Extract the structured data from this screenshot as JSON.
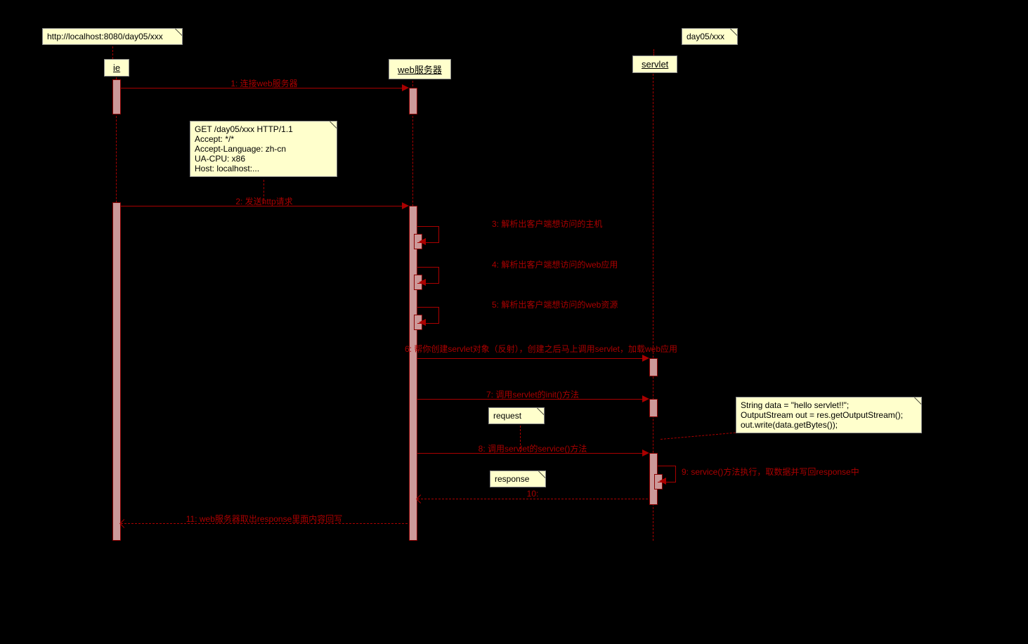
{
  "actors": {
    "ie": "ie",
    "web_server": "web服务器",
    "servlet": "servlet"
  },
  "notes": {
    "url": "http://localhost:8080/day05/xxx",
    "app": "day05/xxx",
    "http_request": "GET /day05/xxx HTTP/1.1\nAccept: */*\nAccept-Language: zh-cn\nUA-CPU: x86\nHost: localhost:...",
    "request_obj": "request",
    "response_obj": "response",
    "servlet_code": "String data = \"hello servlet!!\";\nOutputStream out = res.getOutputStream();\nout.write(data.getBytes());"
  },
  "messages": {
    "m1": "1: 连接web服务器",
    "m2": "2: 发送http请求",
    "m3": "3: 解析出客户端想访问的主机",
    "m4": "4: 解析出客户端想访问的web应用",
    "m5": "5: 解析出客户端想访问的web资源",
    "m6": "6: 帮你创建servlet对象（反射），创建之后马上调用servlet，加载web应用",
    "m7": "7: 调用servlet的init()方法",
    "m8": "8: 调用servlet的service()方法",
    "m9": "9: service()方法执行，取数据并写回response中",
    "m10": "10:",
    "m11": "11: web服务器取出response里面内容回写"
  },
  "chart_data": {
    "type": "sequence_diagram",
    "participants": [
      "ie",
      "web服务器",
      "servlet"
    ],
    "interactions": [
      {
        "from": "ie",
        "to": "web服务器",
        "label": "1: 连接web服务器",
        "type": "sync"
      },
      {
        "from": "ie",
        "to": "web服务器",
        "label": "2: 发送http请求",
        "type": "sync",
        "note": "GET /day05/xxx HTTP/1.1..."
      },
      {
        "from": "web服务器",
        "to": "web服务器",
        "label": "3: 解析出客户端想访问的主机",
        "type": "self"
      },
      {
        "from": "web服务器",
        "to": "web服务器",
        "label": "4: 解析出客户端想访问的web应用",
        "type": "self"
      },
      {
        "from": "web服务器",
        "to": "web服务器",
        "label": "5: 解析出客户端想访问的web资源",
        "type": "self"
      },
      {
        "from": "web服务器",
        "to": "servlet",
        "label": "6: 帮你创建servlet对象（反射），创建之后马上调用servlet，加载web应用",
        "type": "sync"
      },
      {
        "from": "web服务器",
        "to": "servlet",
        "label": "7: 调用servlet的init()方法",
        "type": "sync"
      },
      {
        "from": "web服务器",
        "to": "servlet",
        "label": "8: 调用servlet的service()方法",
        "type": "sync",
        "note_obj": "request"
      },
      {
        "from": "servlet",
        "to": "servlet",
        "label": "9: service()方法执行，取数据并写回response中",
        "type": "self"
      },
      {
        "from": "servlet",
        "to": "web服务器",
        "label": "10:",
        "type": "return",
        "note_obj": "response"
      },
      {
        "from": "web服务器",
        "to": "ie",
        "label": "11: web服务器取出response里面内容回写",
        "type": "return"
      }
    ]
  }
}
